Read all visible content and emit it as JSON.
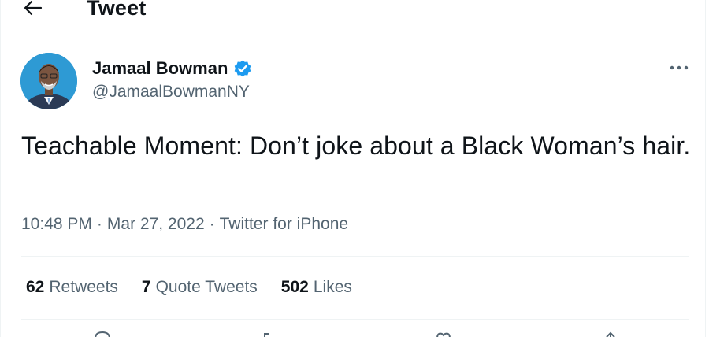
{
  "header": {
    "back_icon": "arrow-left-icon",
    "title": "Tweet"
  },
  "author": {
    "name": "Jamaal Bowman",
    "handle": "@JamaalBowmanNY",
    "verified": true,
    "verified_color": "#1d9bf0"
  },
  "tweet": {
    "text": "Teachable Moment: Don’t joke about a Black Woman’s hair."
  },
  "meta": {
    "time": "10:48 PM",
    "separator": "·",
    "date": "Mar 27, 2022",
    "source": "Twitter for iPhone"
  },
  "stats": {
    "retweets_count": "62",
    "retweets_label": "Retweets",
    "quotes_count": "7",
    "quotes_label": "Quote Tweets",
    "likes_count": "502",
    "likes_label": "Likes"
  },
  "actions": [
    "reply-icon",
    "retweet-icon",
    "like-icon",
    "share-icon"
  ],
  "colors": {
    "text_primary": "#0f1419",
    "text_secondary": "#536471",
    "divider": "#eff3f4",
    "avatar_bg": "#2e9ad4"
  }
}
